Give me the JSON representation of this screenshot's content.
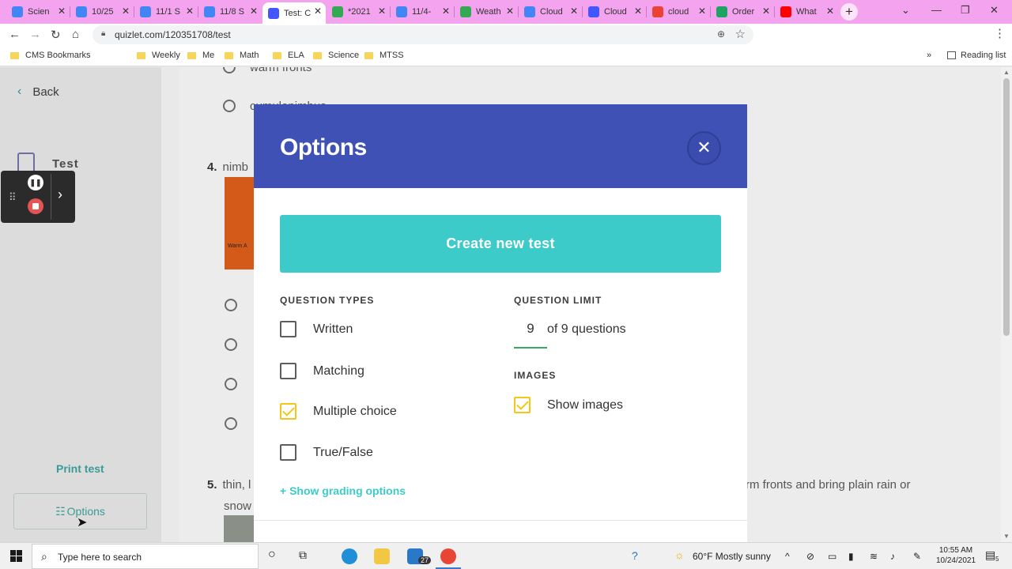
{
  "browser": {
    "tabs": [
      {
        "label": "Scien",
        "color": "#4285f4"
      },
      {
        "label": "10/25",
        "color": "#4285f4"
      },
      {
        "label": "11/1 S",
        "color": "#4285f4"
      },
      {
        "label": "11/8 S",
        "color": "#4285f4"
      },
      {
        "label": "Test: C",
        "color": "#4255ff",
        "active": true
      },
      {
        "label": "*2021",
        "color": "#34a853"
      },
      {
        "label": "11/4-",
        "color": "#4285f4"
      },
      {
        "label": "Weath",
        "color": "#34a853"
      },
      {
        "label": "Cloud",
        "color": "#4285f4"
      },
      {
        "label": "Cloud",
        "color": "#4255ff"
      },
      {
        "label": "cloud",
        "color": "#ea4335"
      },
      {
        "label": "Order",
        "color": "#1ea362"
      },
      {
        "label": "What",
        "color": "#ff0000"
      }
    ],
    "url": "quizlet.com/120351708/test",
    "bookmarks": [
      {
        "label": "CMS Bookmarks"
      },
      {
        "label": "Weekly"
      },
      {
        "label": "Me"
      },
      {
        "label": "Math"
      },
      {
        "label": "ELA"
      },
      {
        "label": "Science"
      },
      {
        "label": "MTSS"
      }
    ],
    "reading_list": "Reading list"
  },
  "sidebar": {
    "back": "Back",
    "section": "Test",
    "print": "Print test",
    "options": "Options"
  },
  "quiz": {
    "opt_warm_fronts": "warm fronts",
    "opt_cumulonimbus": "cumulonimbus",
    "q4_number": "4.",
    "q4_text": "nimb",
    "q4_image_caption": "Warm A",
    "q5_number": "5.",
    "q5_text_start": "thin, l",
    "q5_text_end": "rm fronts and bring plain rain or",
    "q5_text_line2": "snow"
  },
  "modal": {
    "title": "Options",
    "create_button": "Create new test",
    "question_types_heading": "QUESTION TYPES",
    "question_types": [
      {
        "label": "Written",
        "checked": false
      },
      {
        "label": "Matching",
        "checked": false
      },
      {
        "label": "Multiple choice",
        "checked": true
      },
      {
        "label": "True/False",
        "checked": false
      }
    ],
    "question_limit_heading": "QUESTION LIMIT",
    "question_limit_value": "9",
    "question_limit_of": "of 9 questions",
    "images_heading": "IMAGES",
    "show_images_label": "Show images",
    "show_images_checked": true,
    "grading_link": "+ Show grading options"
  },
  "taskbar": {
    "search_placeholder": "Type here to search",
    "mail_badge": "27",
    "weather": "60°F  Mostly sunny",
    "time": "10:55 AM",
    "date": "10/24/2021",
    "notifications": "5"
  }
}
